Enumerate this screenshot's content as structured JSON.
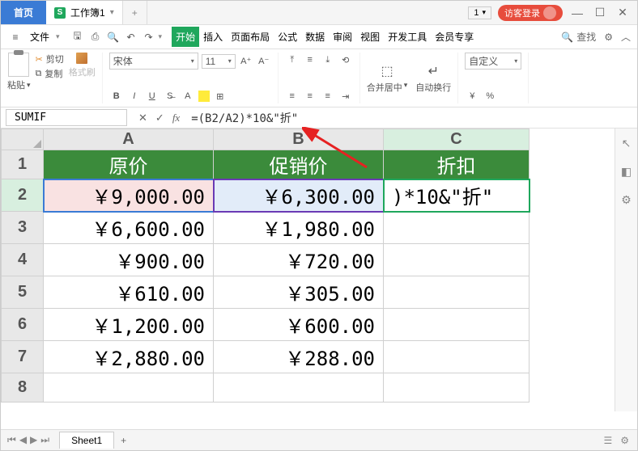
{
  "titlebar": {
    "home": "首页",
    "workbook": "工作簿1",
    "plus": "+",
    "page_indicator": "1",
    "login": "访客登录"
  },
  "menu": {
    "file": "文件",
    "tabs": [
      "开始",
      "插入",
      "页面布局",
      "公式",
      "数据",
      "审阅",
      "视图",
      "开发工具",
      "会员专享"
    ],
    "active_tab": 0,
    "search": "查找"
  },
  "ribbon": {
    "paste": "粘贴",
    "cut": "剪切",
    "copy": "复制",
    "format_painter": "格式刷",
    "font_name": "宋体",
    "font_size": "11",
    "merge": "合并居中",
    "wrap": "自动换行",
    "num_format": "自定义"
  },
  "formula": {
    "name_box": "SUMIF",
    "formula": "=(B2/A2)*10&\"折\""
  },
  "sheet": {
    "columns": [
      "A",
      "B",
      "C"
    ],
    "rows": [
      "1",
      "2",
      "3",
      "4",
      "5",
      "6",
      "7",
      "8"
    ],
    "headers": [
      "原价",
      "促销价",
      "折扣"
    ],
    "data": [
      [
        "￥9,000.00",
        "￥6,300.00",
        ")*10&\"折\""
      ],
      [
        "￥6,600.00",
        "￥1,980.00",
        ""
      ],
      [
        "￥900.00",
        "￥720.00",
        ""
      ],
      [
        "￥610.00",
        "￥305.00",
        ""
      ],
      [
        "￥1,200.00",
        "￥600.00",
        ""
      ],
      [
        "￥2,880.00",
        "￥288.00",
        ""
      ],
      [
        "",
        "",
        ""
      ]
    ],
    "active_tab": "Sheet1",
    "tab_add": "+"
  }
}
